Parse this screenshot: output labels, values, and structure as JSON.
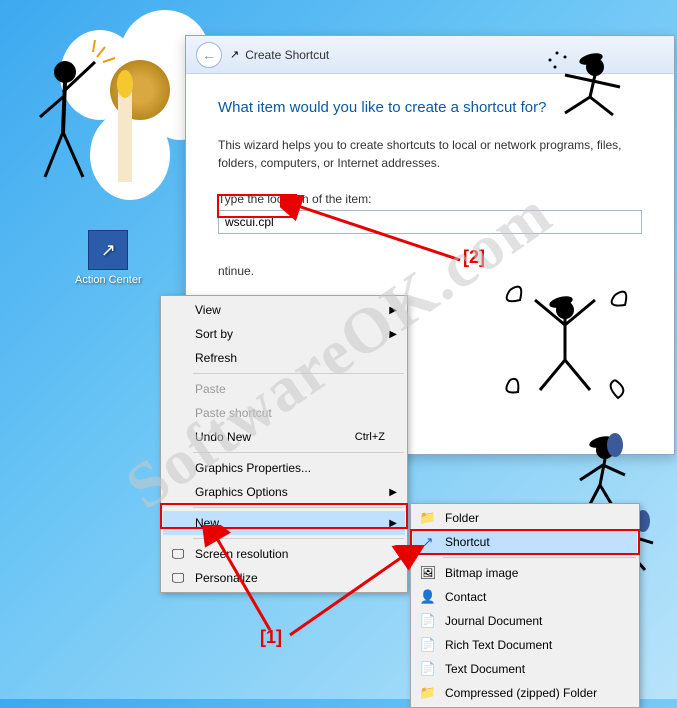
{
  "desktop": {
    "icon_label": "Action Center"
  },
  "wizard": {
    "title": "Create Shortcut",
    "heading": "What item would you like to create a shortcut for?",
    "body": "This wizard helps you to create shortcuts to local or network programs, files, folders, computers, or Internet addresses.",
    "input_label": "Type the location of the item:",
    "input_value": "wscui.cpl",
    "continue_hint": "ntinue."
  },
  "context_main": {
    "view": "View",
    "sort": "Sort by",
    "refresh": "Refresh",
    "paste": "Paste",
    "paste_shortcut": "Paste shortcut",
    "undo": "Undo New",
    "undo_kbd": "Ctrl+Z",
    "gfx_props": "Graphics Properties...",
    "gfx_opts": "Graphics Options",
    "new": "New",
    "screen_res": "Screen resolution",
    "personalize": "Personalize"
  },
  "context_sub": {
    "folder": "Folder",
    "shortcut": "Shortcut",
    "bitmap": "Bitmap image",
    "contact": "Contact",
    "journal": "Journal Document",
    "rtf": "Rich Text Document",
    "text": "Text Document",
    "zip": "Compressed (zipped) Folder"
  },
  "annotations": {
    "label1": "[1]",
    "label2": "[2]"
  },
  "watermark": "SoftwareOK.com"
}
